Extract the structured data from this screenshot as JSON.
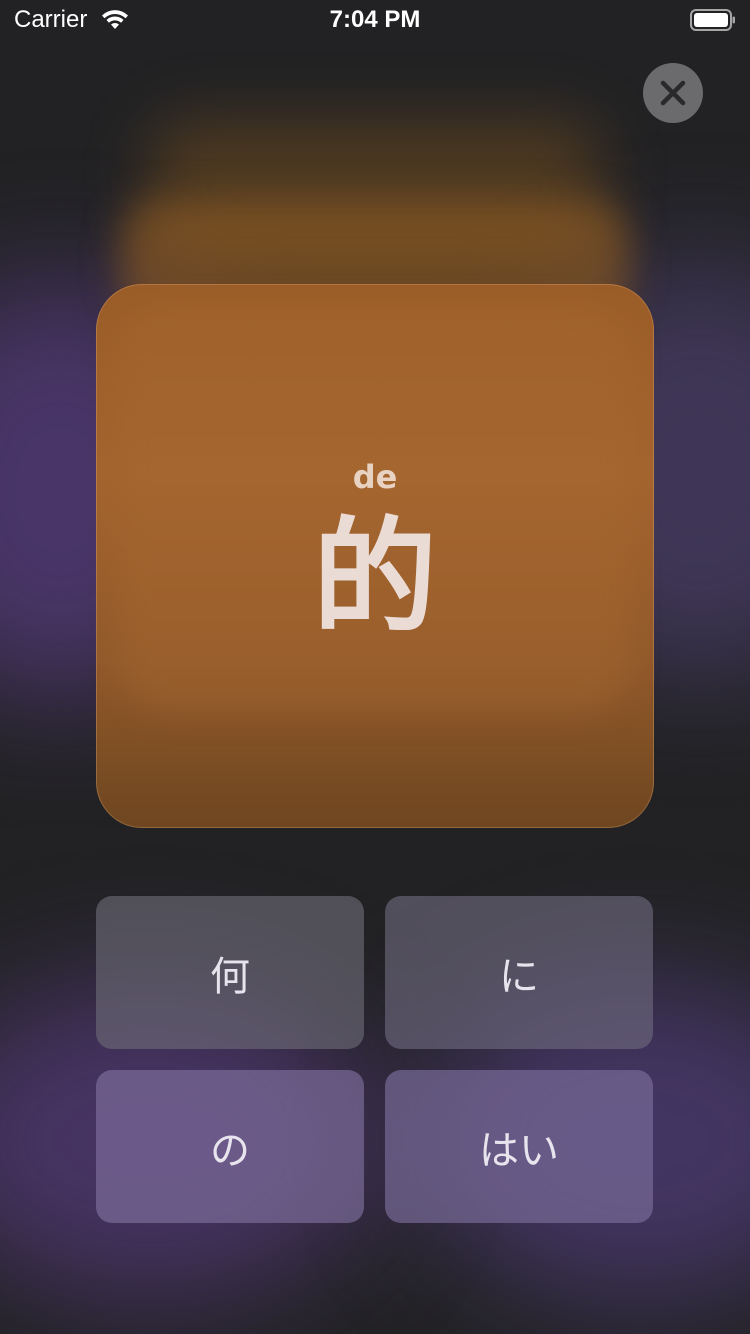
{
  "status_bar": {
    "carrier": "Carrier",
    "time": "7:04 PM"
  },
  "close_button": {
    "icon": "close-icon"
  },
  "card": {
    "romanization": "de",
    "character": "的"
  },
  "answers": [
    {
      "label": "何"
    },
    {
      "label": "に"
    },
    {
      "label": "の"
    },
    {
      "label": "はい"
    }
  ],
  "colors": {
    "card": "#a4642f",
    "text_light": "#eadcd4",
    "close_button": "#6b6b6d",
    "close_icon": "#2a2a2c"
  }
}
